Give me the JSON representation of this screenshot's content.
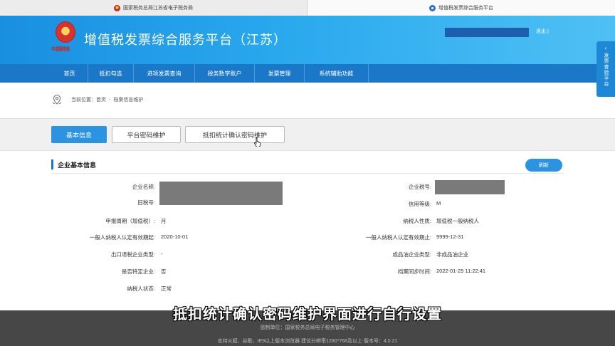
{
  "browser_tabs": [
    {
      "label": "国家税务总局江苏省电子税务局"
    },
    {
      "label": "增值税发票综合服务平台"
    }
  ],
  "header": {
    "logo_text": "中国税务",
    "title": "增值税发票综合服务平台（江苏）",
    "logout_label": "退出 |"
  },
  "nav": {
    "items": [
      {
        "label": "首页"
      },
      {
        "label": "抵扣勾选"
      },
      {
        "label": "进项发票查询"
      },
      {
        "label": "税务数字账户"
      },
      {
        "label": "发票管理"
      },
      {
        "label": "系统辅助功能"
      }
    ]
  },
  "side_tab": {
    "label": "发票查验平台"
  },
  "breadcrumb": {
    "prefix": "当前位置：",
    "home": "首页",
    "separator": "-",
    "current": "档案信息维护"
  },
  "subtabs": [
    {
      "label": "基本信息",
      "active": true
    },
    {
      "label": "平台密码维护",
      "active": false
    },
    {
      "label": "抵扣统计确认密码维护",
      "active": false
    }
  ],
  "section": {
    "title": "企业基本信息",
    "refresh_label": "刷新"
  },
  "info_left": [
    {
      "label": "企业名称:",
      "value": ""
    },
    {
      "label": "旧税号:",
      "value": ""
    },
    {
      "label": "申报周期（增值税）:",
      "value": "月"
    },
    {
      "label": "一般人纳税人认定有效期起:",
      "value": "2020-10-01"
    },
    {
      "label": "出口退税企业类型:",
      "value": "-"
    },
    {
      "label": "是否特定企业:",
      "value": "否"
    },
    {
      "label": "纳税人状态:",
      "value": "正常"
    }
  ],
  "info_right": [
    {
      "label": "企业税号:",
      "value": ""
    },
    {
      "label": "信用等级:",
      "value": "M"
    },
    {
      "label": "纳税人性质:",
      "value": "增值税一般纳税人"
    },
    {
      "label": "一般人纳税人认定有效期止:",
      "value": "9999-12-31"
    },
    {
      "label": "成品油企业类型:",
      "value": "非成品油企业"
    },
    {
      "label": "档案同步时间:",
      "value": "2022-01-25 11:22:41"
    }
  ],
  "caption": "抵扣统计确认密码维护界面进行自行设置",
  "footer": {
    "line1": "监制单位：国家税务总局电子税务管理中心",
    "line2": "支持火狐、谷歌、IE9以上版本浏览器    建议分辨率1280*768及以上    版本号：4.0.21"
  },
  "colors": {
    "header_blue": "#29a8ee",
    "nav_blue": "#1b78c8",
    "accent": "#2b93e2"
  }
}
